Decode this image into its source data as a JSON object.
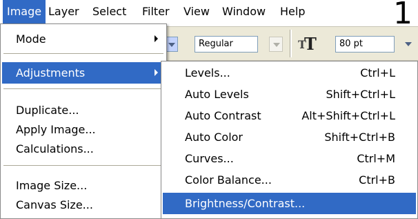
{
  "menubar": {
    "items": [
      "Image",
      "Layer",
      "Select",
      "Filter",
      "View",
      "Window",
      "Help"
    ],
    "step_number": "1"
  },
  "options_bar": {
    "font_style": "Regular",
    "font_size": "80 pt"
  },
  "image_menu": {
    "items": [
      {
        "label": "Mode",
        "has_submenu": true
      },
      {
        "label": "Adjustments",
        "has_submenu": true,
        "highlighted": true
      },
      {
        "label": "Duplicate..."
      },
      {
        "label": "Apply Image..."
      },
      {
        "label": "Calculations..."
      },
      {
        "label": "Image Size..."
      },
      {
        "label": "Canvas Size..."
      }
    ]
  },
  "adjustments_menu": {
    "items": [
      {
        "label": "Levels...",
        "shortcut": "Ctrl+L"
      },
      {
        "label": "Auto Levels",
        "shortcut": "Shift+Ctrl+L"
      },
      {
        "label": "Auto Contrast",
        "shortcut": "Alt+Shift+Ctrl+L"
      },
      {
        "label": "Auto Color",
        "shortcut": "Shift+Ctrl+B"
      },
      {
        "label": "Curves...",
        "shortcut": "Ctrl+M"
      },
      {
        "label": "Color Balance...",
        "shortcut": "Ctrl+B"
      },
      {
        "label": "Brightness/Contrast...",
        "shortcut": "",
        "highlighted": true
      }
    ]
  },
  "colors": {
    "highlight": "#316ac5",
    "toolbar_bg": "#ece9d8"
  }
}
